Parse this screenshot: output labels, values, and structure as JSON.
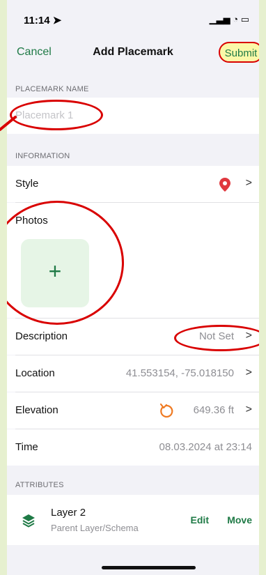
{
  "status": {
    "time": "11:14 ➤",
    "icons": "▁▃▅ ◔ ▭"
  },
  "nav": {
    "cancel": "Cancel",
    "title": "Add Placemark",
    "submit": "Submit"
  },
  "sections": {
    "name": "PLACEMARK NAME",
    "info": "INFORMATION",
    "attrs": "ATTRIBUTES"
  },
  "name_field": {
    "placeholder": "Placemark 1"
  },
  "rows": {
    "style": {
      "label": "Style"
    },
    "photos": {
      "label": "Photos",
      "add": "+"
    },
    "description": {
      "label": "Description",
      "value": "Not Set"
    },
    "location": {
      "label": "Location",
      "value": "41.553154, -75.018150"
    },
    "elevation": {
      "label": "Elevation",
      "value": "649.36 ft"
    },
    "time": {
      "label": "Time",
      "value": "08.03.2024 at 23:14"
    }
  },
  "attributes": {
    "layer": "Layer 2",
    "sub": "Parent Layer/Schema",
    "edit": "Edit",
    "move": "Move"
  },
  "chevron": ">",
  "colors": {
    "accent": "#1f7a46",
    "highlight": "#d90000",
    "pin": "#e0383e",
    "refresh": "#ef7a22"
  }
}
